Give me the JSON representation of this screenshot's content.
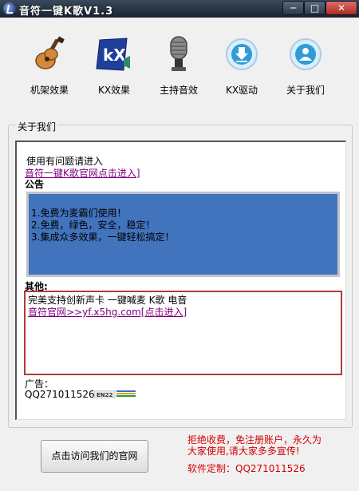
{
  "window": {
    "title": "音符一键K歌V1.3"
  },
  "controls": {
    "minimize": "─",
    "maximize": "□",
    "close": "✕"
  },
  "toolbar": {
    "items": [
      {
        "label": "机架效果",
        "icon": "guitar-icon"
      },
      {
        "label": "KX效果",
        "icon": "kx-icon"
      },
      {
        "label": "主持音效",
        "icon": "microphone-icon"
      },
      {
        "label": "KX驱动",
        "icon": "download-icon"
      },
      {
        "label": "关于我们",
        "icon": "user-icon"
      }
    ]
  },
  "about": {
    "group_title": "关于我们",
    "help_text": "使用有问题请进入",
    "site_link": "音符一键K歌官网点击进入]",
    "notice_title": "公告",
    "notice_lines": [
      "1.免费为麦霸们使用！",
      "2.免费，绿色，安全，稳定！",
      "3.集成众多效果，一键轻松搞定！"
    ],
    "other_title": "其他:",
    "other_line1": "完美支持创新声卡 一键喊麦 K歌 电音",
    "other_link": "音符官网>>yf.x5hg.com[点击进入]",
    "ad_label": "广告：",
    "ad_qq": "QQ271011526",
    "ad_badge_text": "EN22"
  },
  "footer": {
    "visit_button": "点击访问我们的官网",
    "notice_line1": "拒绝收费，免注册账户，永久为",
    "notice_line2": "大家使用,请大家多多宣传!",
    "custom": "软件定制：QQ271011526"
  },
  "colors": {
    "notice_bg": "#4273bd",
    "link": "#800080",
    "accent_red": "#d60000",
    "other_border": "#b03a3a"
  }
}
